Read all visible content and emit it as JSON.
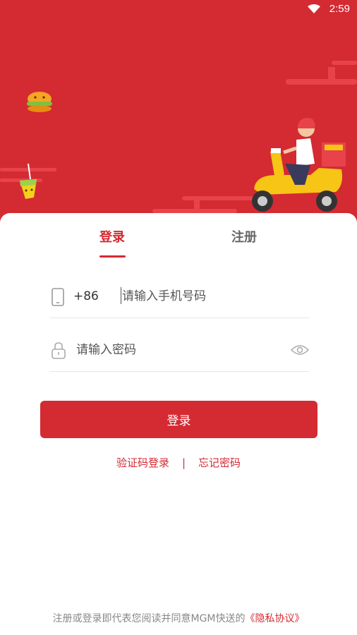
{
  "status_bar": {
    "time": "2:59",
    "icons": [
      "wifi-icon"
    ]
  },
  "tabs": [
    {
      "label": "登录",
      "active": true
    },
    {
      "label": "注册",
      "active": false
    }
  ],
  "phone": {
    "icon": "phone-icon",
    "country_code": "+86",
    "placeholder": "请输入手机号码",
    "value": ""
  },
  "password": {
    "icon": "lock-icon",
    "placeholder": "请输入密码",
    "value": "",
    "toggle_icon": "eye-icon"
  },
  "login_button": "登录",
  "links": {
    "sms_login": "验证码登录",
    "separator": "|",
    "forgot_password": "忘记密码"
  },
  "footer": {
    "text": "注册或登录即代表您阅读并同意MGM快送的",
    "link": "《隐私协议》"
  },
  "colors": {
    "brand": "#d42a32",
    "background": "#ffffff"
  }
}
